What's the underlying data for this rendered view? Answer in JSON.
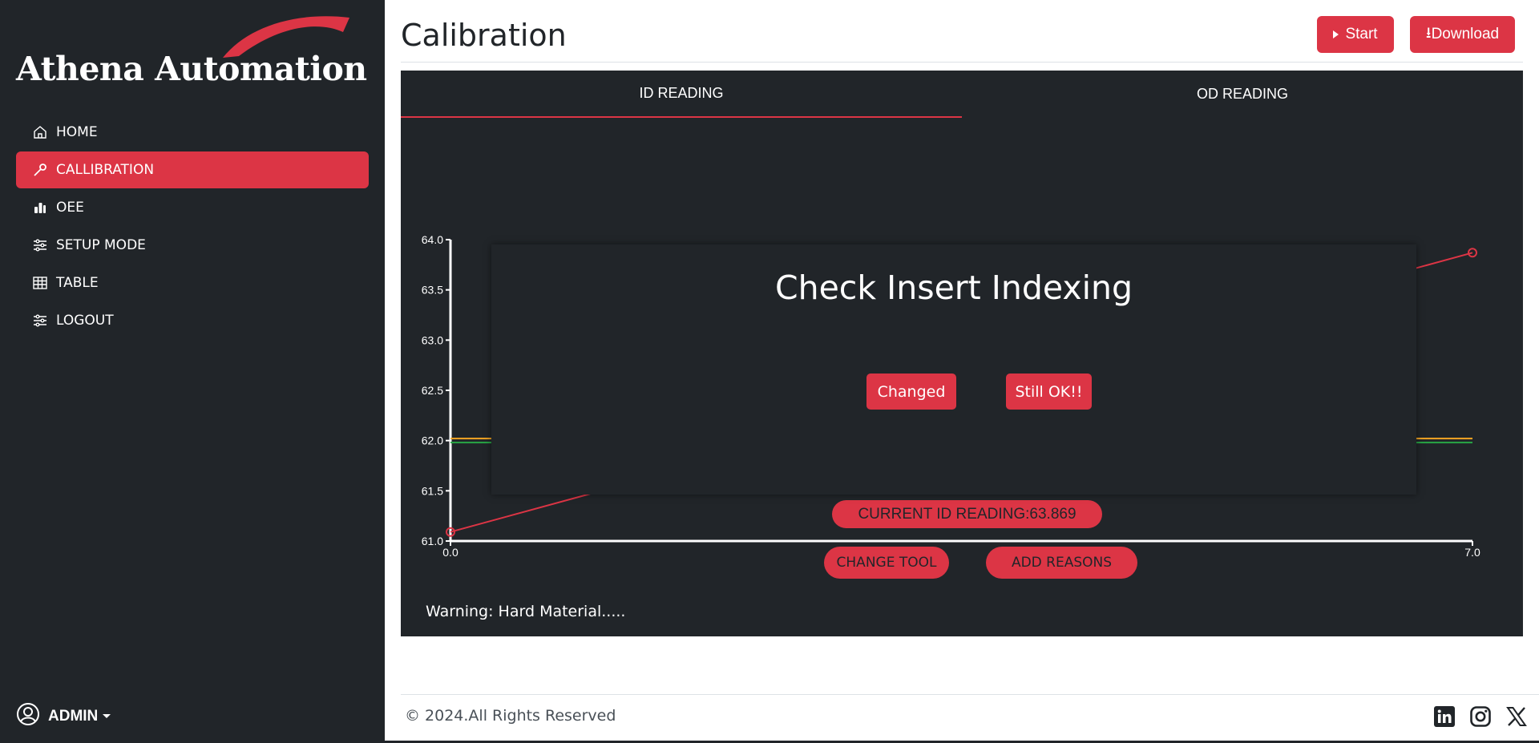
{
  "brand": {
    "name": "Athena Automation",
    "accent": "#dc3545",
    "sidebar_bg": "#212529"
  },
  "sidebar": {
    "items": [
      {
        "label": "HOME",
        "icon": "home-icon",
        "active": false
      },
      {
        "label": "CALLIBRATION",
        "icon": "wrench-icon",
        "active": true
      },
      {
        "label": "OEE",
        "icon": "bar-chart-icon",
        "active": false
      },
      {
        "label": "SETUP MODE",
        "icon": "sliders-icon",
        "active": false
      },
      {
        "label": "TABLE",
        "icon": "table-icon",
        "active": false
      },
      {
        "label": "LOGOUT",
        "icon": "sliders-icon",
        "active": false
      }
    ],
    "user": {
      "name": "ADMIN",
      "icon": "user-circle-icon"
    }
  },
  "header": {
    "title": "Calibration",
    "start_label": "Start",
    "download_label": "Download",
    "download_glyph": "⭳"
  },
  "tabs": [
    {
      "label": "ID READING",
      "active": true
    },
    {
      "label": "OD READING",
      "active": false
    }
  ],
  "chart_data": {
    "type": "line",
    "x_ticks": [
      "0.0",
      "7.0"
    ],
    "y_ticks": [
      "61.0",
      "61.5",
      "62.0",
      "62.5",
      "63.0",
      "63.5",
      "64.0"
    ],
    "ylim": [
      61.0,
      64.0
    ],
    "xlim": [
      0,
      7
    ],
    "series": [
      {
        "color": "#dc3545",
        "points": [
          [
            0,
            61.09
          ],
          [
            7,
            63.87
          ]
        ]
      }
    ],
    "reference_lines": [
      {
        "y": 62.02,
        "color": "#f5a623"
      },
      {
        "y": 61.98,
        "color": "#28a745"
      }
    ]
  },
  "reading": {
    "label": "CURRENT ID READING",
    "separator": ":",
    "value": "63.869"
  },
  "actions": {
    "change_tool": "CHANGE TOOL",
    "add_reasons": "ADD REASONS"
  },
  "warning": "Warning: Hard Material.....",
  "modal": {
    "title": "Check Insert Indexing",
    "changed_label": "Changed",
    "still_ok_label": "Still OK!!"
  },
  "footer": {
    "copyright": "© 2024.All Rights Reserved",
    "social": [
      "linkedin-icon",
      "instagram-icon",
      "x-icon"
    ]
  }
}
